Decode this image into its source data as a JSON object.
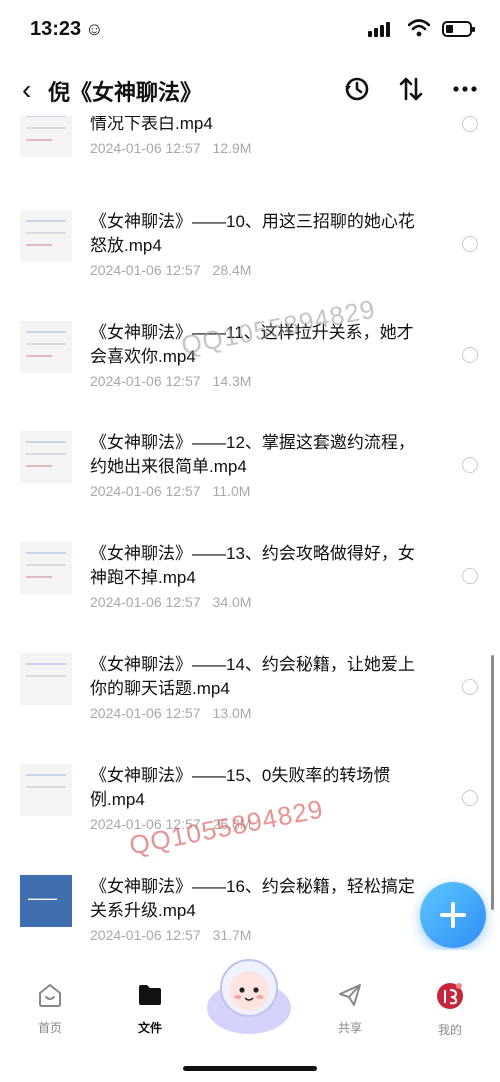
{
  "status": {
    "time": "13:23"
  },
  "nav": {
    "title": "倪《女神聊法》"
  },
  "files": [
    {
      "name": "情况下表白.mp4",
      "date": "2024-01-06 12:57",
      "size": "12.9M"
    },
    {
      "name": "《女神聊法》——10、用这三招聊的她心花怒放.mp4",
      "date": "2024-01-06 12:57",
      "size": "28.4M"
    },
    {
      "name": "《女神聊法》——11、这样拉升关系，她才会喜欢你.mp4",
      "date": "2024-01-06 12:57",
      "size": "14.3M"
    },
    {
      "name": "《女神聊法》——12、掌握这套邀约流程，约她出来很简单.mp4",
      "date": "2024-01-06 12:57",
      "size": "11.0M"
    },
    {
      "name": "《女神聊法》——13、约会攻略做得好，女神跑不掉.mp4",
      "date": "2024-01-06 12:57",
      "size": "34.0M"
    },
    {
      "name": "《女神聊法》——14、约会秘籍，让她爱上你的聊天话题.mp4",
      "date": "2024-01-06 12:57",
      "size": "13.0M"
    },
    {
      "name": "《女神聊法》——15、0失败率的转场惯例.mp4",
      "date": "2024-01-06 12:57",
      "size": "26.0M"
    },
    {
      "name": "《女神聊法》——16、约会秘籍，轻松搞定关系升级.mp4",
      "date": "2024-01-06 12:57",
      "size": "31.7M"
    }
  ],
  "watermarks": [
    "QQ1055894829",
    "QQ1055894829"
  ],
  "tabs": [
    {
      "label": "首页",
      "icon": "home-icon"
    },
    {
      "label": "文件",
      "icon": "folder-icon"
    },
    {
      "label": "共享",
      "icon": "share-icon"
    },
    {
      "label": "我的",
      "icon": "avatar-icon"
    }
  ],
  "colors": {
    "fab": "#2f8ef5",
    "watermark": "#e16e6e"
  }
}
